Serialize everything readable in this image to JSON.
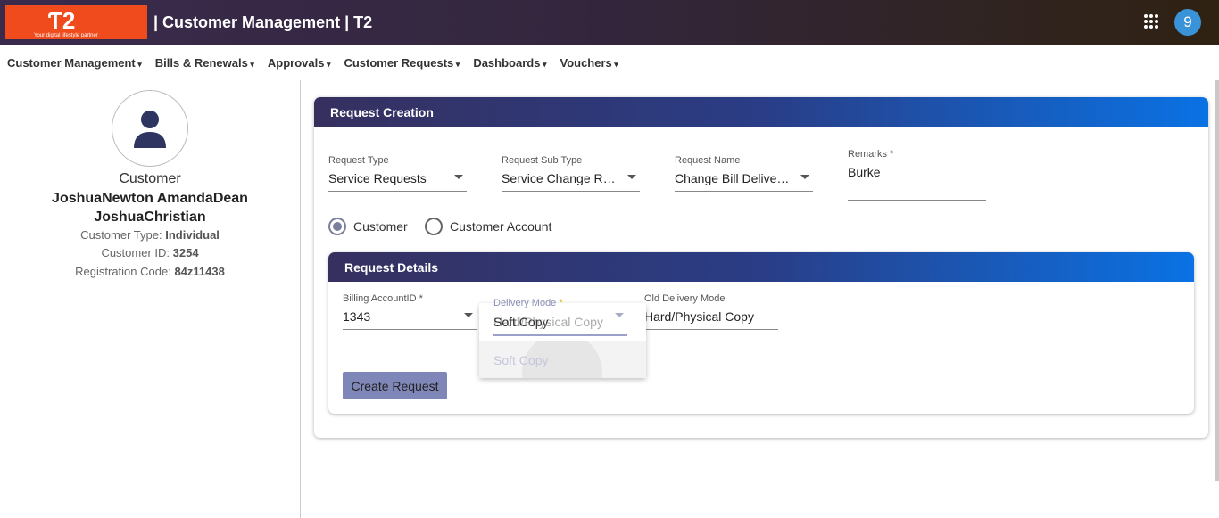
{
  "header": {
    "logo_text": "T2",
    "logo_tagline": "Your digital lifestyle partner",
    "title": "| Customer Management | T2",
    "apps_icon": "grid-icon",
    "notification_count": "9"
  },
  "nav": [
    "Customer Management",
    "Bills & Renewals",
    "Approvals",
    "Customer Requests",
    "Dashboards",
    "Vouchers"
  ],
  "customer": {
    "label": "Customer",
    "name": "JoshuaNewton AmandaDean JoshuaChristian",
    "type_label": "Customer Type:",
    "type": "Individual",
    "id_label": "Customer ID:",
    "id": "3254",
    "reg_label": "Registration Code:",
    "reg": "84z11438"
  },
  "request": {
    "title": "Request Creation",
    "type_label": "Request Type",
    "type": "Service Requests",
    "subtype_label": "Request Sub Type",
    "subtype": "Service Change Requests",
    "name_label": "Request Name",
    "name": "Change Bill Delivery Mode",
    "remarks_label": "Remarks *",
    "remarks": "Burke",
    "radio_customer": "Customer",
    "radio_account": "Customer Account",
    "selected": "Customer"
  },
  "details": {
    "title": "Request Details",
    "billing_label": "Billing AccountID *",
    "billing": "1343",
    "delivery_label": "Delivery Mode",
    "delivery_req": "*",
    "delivery_value": "Soft Copy",
    "delivery_prev": "Hard/Physical Copy",
    "delivery_option": "Soft Copy",
    "old_label": "Old Delivery Mode",
    "old": "Hard/Physical Copy",
    "create_button": "Create Request"
  },
  "colors": {
    "accent": "#0a72e4",
    "header_dark": "#36305f",
    "button": "#7f86b8",
    "avatar": "#3a93d8"
  }
}
